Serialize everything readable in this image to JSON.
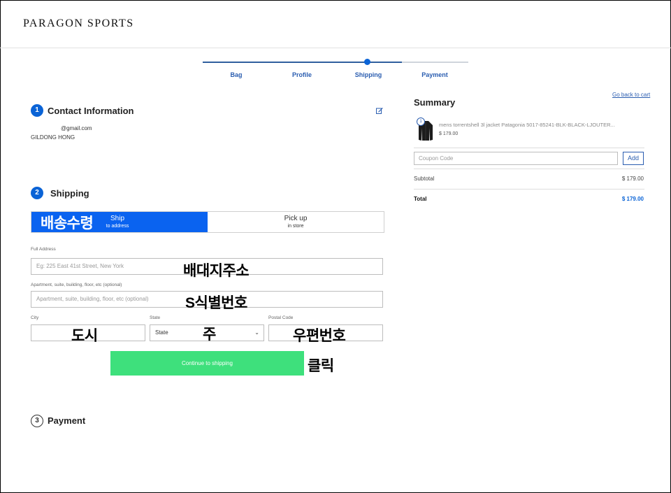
{
  "header": {
    "logo": "PARAGON SPORTS"
  },
  "steps": [
    {
      "label": "Bag"
    },
    {
      "label": "Profile"
    },
    {
      "label": "Shipping"
    },
    {
      "label": "Payment"
    }
  ],
  "contact": {
    "number": "1",
    "title": "Contact Information",
    "email": "@gmail.com",
    "name": "GILDONG HONG"
  },
  "shipping": {
    "number": "2",
    "title": "Shipping",
    "ship_option": {
      "label": "Ship",
      "sub": "to address"
    },
    "pickup_option": {
      "label": "Pick up",
      "sub": "in store"
    },
    "full_address": {
      "label": "Full Address",
      "placeholder": "Eg: 225 East 41st Street, New York"
    },
    "apartment": {
      "label": "Apartment, suite, building, floor, etc (optional)",
      "placeholder": "Apartment, suite, building, floor, etc (optional)"
    },
    "city": {
      "label": "City",
      "value": ""
    },
    "state": {
      "label": "State",
      "value": "State"
    },
    "postal": {
      "label": "Postal Code",
      "value": ""
    },
    "continue_label": "Continue to shipping"
  },
  "payment": {
    "number": "3",
    "title": "Payment"
  },
  "annotations": {
    "ship_option": "배송수령",
    "full_address": "배대지주소",
    "apartment": "S식별번호",
    "city": "도시",
    "state": "주",
    "postal": "우편번호",
    "continue": "클릭"
  },
  "summary": {
    "title": "Summary",
    "back_link": "Go back to cart",
    "item": {
      "qty": "1",
      "name": "mens torrentshell 3l jacket Patagonia 5017-85241-BLK-BLACK-LJOUTER...",
      "price": "$ 179.00"
    },
    "coupon_placeholder": "Coupon Code",
    "add_label": "Add",
    "subtotal_label": "Subtotal",
    "subtotal_value": "$ 179.00",
    "total_label": "Total",
    "total_value": "$ 179.00"
  },
  "colors": {
    "accent": "#0a63d6",
    "cta": "#3ee07c",
    "link": "#2a5db0"
  }
}
